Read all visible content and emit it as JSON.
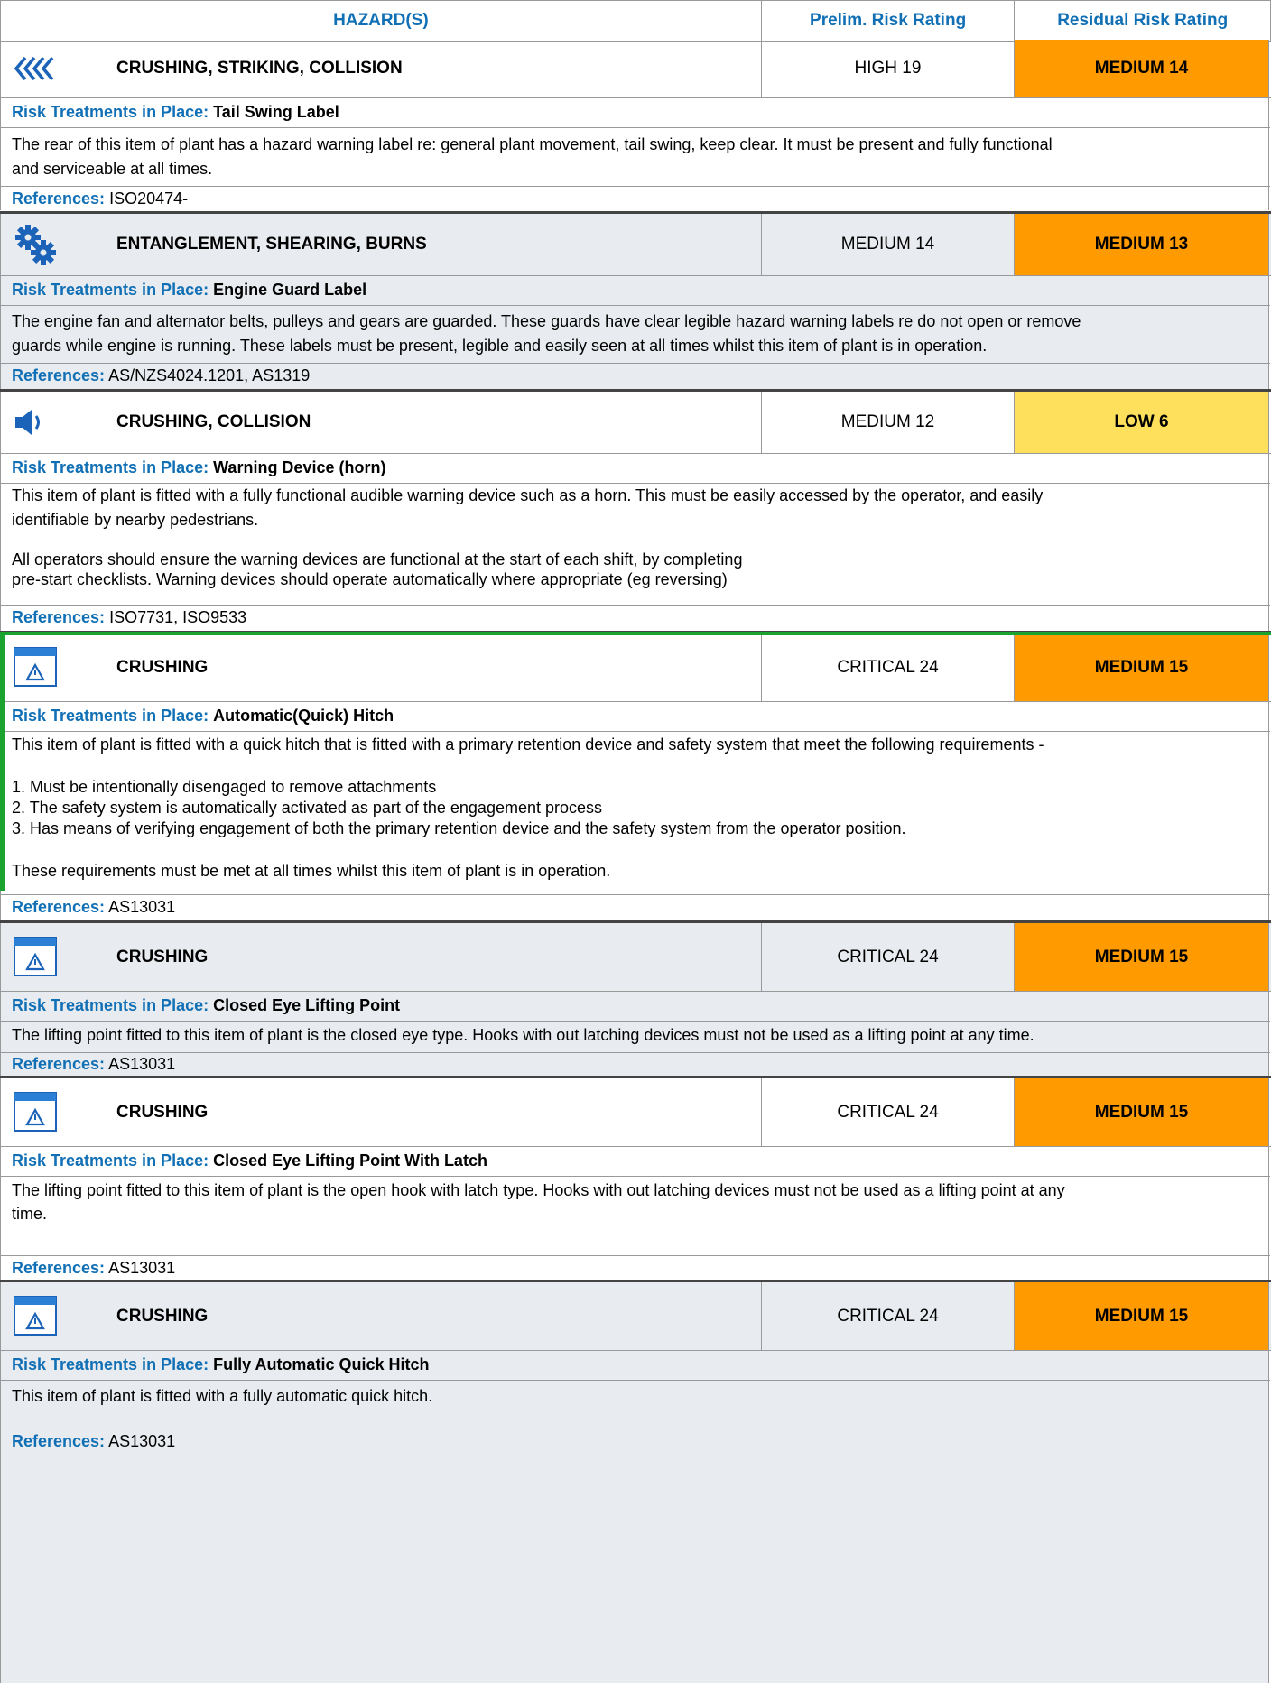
{
  "header": {
    "hazards": "HAZARD(S)",
    "prelim": "Prelim. Risk Rating",
    "residual": "Residual Risk Rating"
  },
  "labels": {
    "treatments": "Risk Treatments in Place:",
    "references": "References:"
  },
  "colors": {
    "accent": "#1170b5",
    "medium": "#ff9a00",
    "low": "#ffe05c",
    "shade": "#e8ebef"
  },
  "hazards": [
    {
      "icon": "chevrons-left-icon",
      "title": "CRUSHING, STRIKING, COLLISION",
      "prelim": "HIGH 19",
      "residual": "MEDIUM 14",
      "treatment": "Tail Swing Label",
      "description": [
        "The rear of this item of plant has a hazard warning label re: general plant movement, tail swing, keep clear. It must be present and fully functional",
        "and serviceable at all times."
      ],
      "references": "ISO20474-"
    },
    {
      "icon": "gears-icon",
      "title": "ENTANGLEMENT, SHEARING, BURNS",
      "prelim": "MEDIUM 14",
      "residual": "MEDIUM 13",
      "treatment": "Engine Guard Label",
      "description": [
        "The engine fan and alternator belts, pulleys and gears are guarded. These guards have clear legible hazard warning labels re do not open or remove",
        "guards while engine is running. These labels must be present, legible and easily seen at all times whilst this item of plant is in operation."
      ],
      "references": "AS/NZS4024.1201, AS1319"
    },
    {
      "icon": "speaker-icon",
      "title": "CRUSHING, COLLISION",
      "prelim": "MEDIUM 12",
      "residual": "LOW 6",
      "treatment": "Warning Device (horn)",
      "description": [
        "This item of plant is fitted with a fully functional audible warning device such as a horn. This must be easily accessed by the operator, and easily",
        "identifiable by nearby pedestrians.",
        "",
        "All operators should ensure the warning devices are functional at the start of each shift, by completing",
        "pre-start checklists. Warning devices should operate automatically where appropriate (eg reversing)"
      ],
      "references": "ISO7731, ISO9533"
    },
    {
      "icon": "warning-window-icon",
      "title": "CRUSHING",
      "prelim": "CRITICAL 24",
      "residual": "MEDIUM 15",
      "treatment": "Automatic(Quick) Hitch",
      "description": [
        "This item of plant is fitted with a quick hitch that is fitted with a primary retention device and safety system that meet the following requirements -",
        "",
        "1. Must be intentionally disengaged to remove attachments",
        "2. The safety system is automatically activated as part of the engagement process",
        "3. Has means of verifying engagement of both the primary retention device and the safety system from the operator position.",
        "",
        "These requirements must be met at all times whilst this item of plant is in operation."
      ],
      "references": "AS13031"
    },
    {
      "icon": "warning-window-icon",
      "title": "CRUSHING",
      "prelim": "CRITICAL 24",
      "residual": "MEDIUM 15",
      "treatment": "Closed Eye Lifting Point",
      "description": [
        "The lifting point fitted to this item of plant is the closed eye type. Hooks with out latching devices must not be used as a lifting point at any time."
      ],
      "references": "AS13031"
    },
    {
      "icon": "warning-window-icon",
      "title": "CRUSHING",
      "prelim": "CRITICAL 24",
      "residual": "MEDIUM 15",
      "treatment": "Closed Eye Lifting Point With Latch",
      "description": [
        "The lifting point fitted to this item of plant is the open hook with latch type. Hooks with out latching devices must not be used as a lifting point at any",
        "time."
      ],
      "references": "AS13031"
    },
    {
      "icon": "warning-window-icon",
      "title": "CRUSHING",
      "prelim": "CRITICAL 24",
      "residual": "MEDIUM 15",
      "treatment": "Fully Automatic Quick Hitch",
      "description": [
        "This item of plant is fitted with a fully automatic quick hitch."
      ],
      "references": "AS13031"
    }
  ]
}
